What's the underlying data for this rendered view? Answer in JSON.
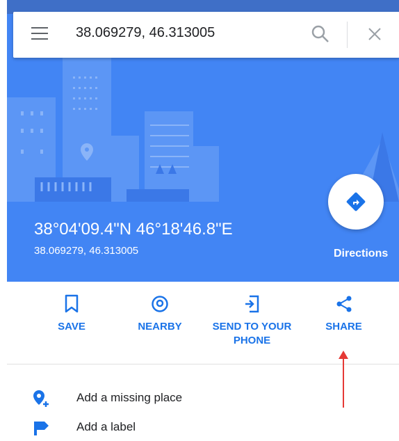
{
  "search": {
    "query": "38.069279, 46.313005",
    "menu_icon": "menu-icon",
    "search_icon": "search-icon",
    "close_icon": "close-icon"
  },
  "place": {
    "title": "38°04'09.4\"N 46°18'46.8\"E",
    "subtitle": "38.069279, 46.313005",
    "directions_label": "Directions",
    "directions_icon": "directions-icon"
  },
  "actions": [
    {
      "label": "SAVE",
      "icon": "bookmark-icon"
    },
    {
      "label": "NEARBY",
      "icon": "nearby-pin-icon"
    },
    {
      "label": "SEND TO YOUR\nPHONE",
      "icon": "send-to-phone-icon"
    },
    {
      "label": "SHARE",
      "icon": "share-icon"
    }
  ],
  "list": [
    {
      "label": "Add a missing place",
      "icon": "add-place-icon"
    },
    {
      "label": "Add a label",
      "icon": "label-flag-icon"
    }
  ],
  "colors": {
    "accent": "#1a73e8",
    "hero": "#4285f4",
    "annotation": "#e53935"
  }
}
